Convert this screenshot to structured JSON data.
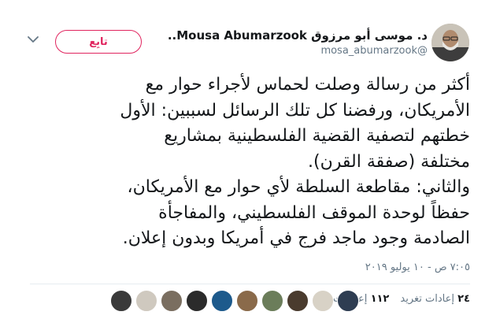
{
  "author": {
    "name": "د. موسى أبو مرزوق Mousa Abumarzook..",
    "handle": "@mosa_abumarzook"
  },
  "follow_button": {
    "label": "تابِع"
  },
  "tweet": {
    "lines": [
      "أكثر من رسالة وصلت لحماس لأجراء حوار مع",
      "الأمريكان، ورفضنا كل تلك الرسائل لسببين: الأول",
      "خطتهم لتصفية القضية الفلسطينية بمشاريع",
      "مختلفة (صفقة القرن).",
      "والثاني: مقاطعة السلطة لأي حوار مع الأمريكان،",
      "حفظاً لوحدة الموقف الفلسطيني، والمفاجأة",
      "الصادمة وجود ماجد فرج في أمريكا وبدون إعلان."
    ]
  },
  "timestamp": "٧:٠٥ ص - ١٠ يوليو ٢٠١٩",
  "stats": {
    "retweets_count": "٢٤",
    "retweets_label": "إعادات تغريد",
    "likes_count": "١١٢",
    "likes_label": "إعجابات"
  },
  "likers": {
    "colors": [
      "#3a3a3a",
      "#cfc9bf",
      "#7a6e60",
      "#2b2b2b",
      "#1d5a8c",
      "#8a6a4a",
      "#6b7d5a",
      "#4a3b2e",
      "#d8d2c6",
      "#2e3d52"
    ]
  },
  "colors": {
    "follow_accent": "#e0245e",
    "secondary_text": "#657786",
    "primary_text": "#14171a"
  }
}
